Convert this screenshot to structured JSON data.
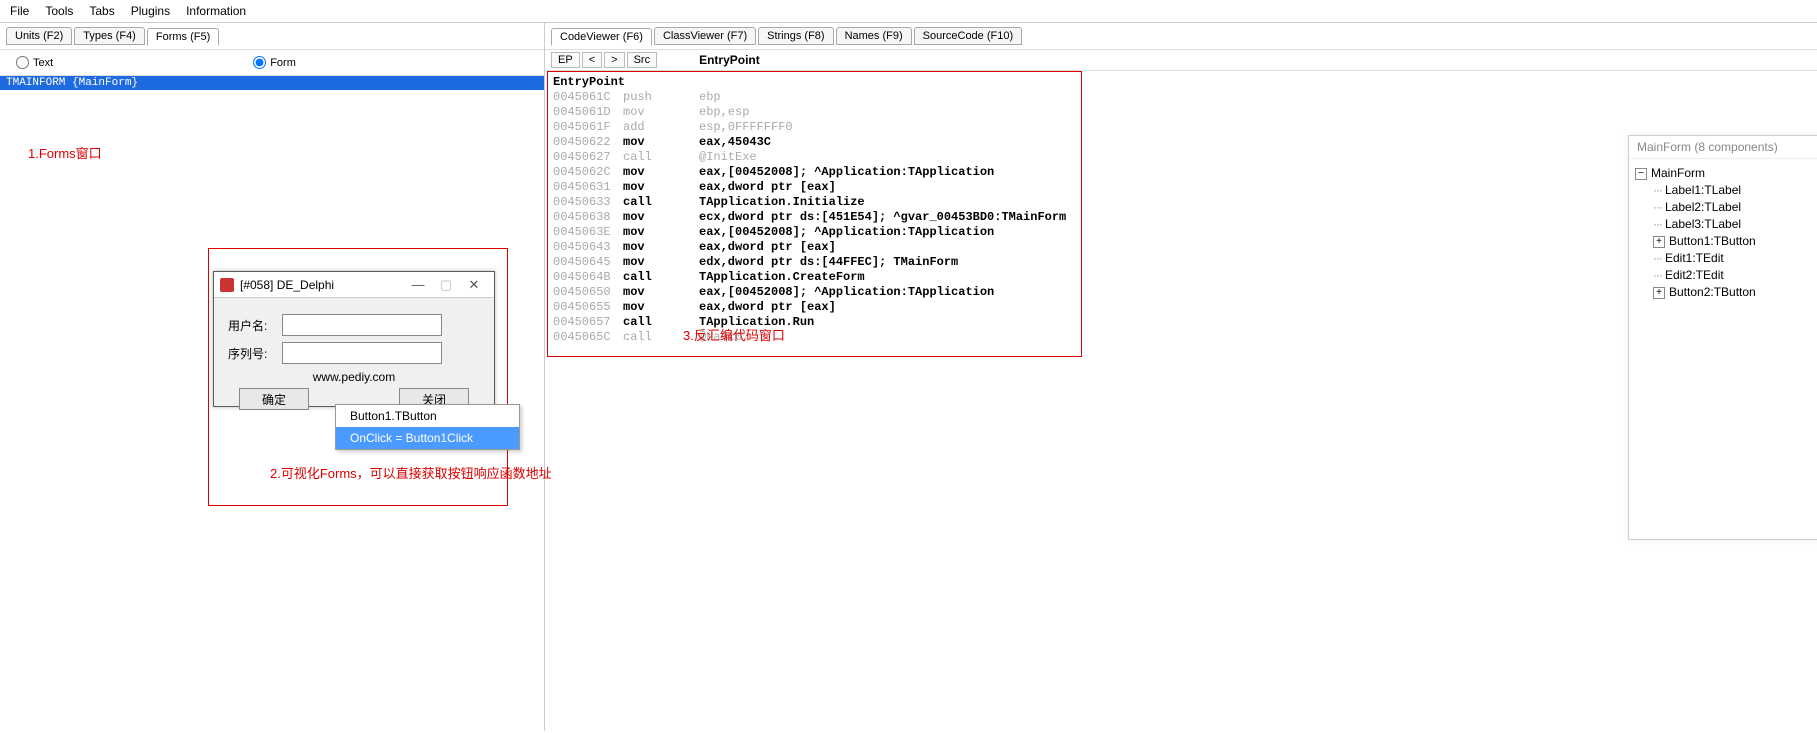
{
  "menu": {
    "file": "File",
    "tools": "Tools",
    "tabs": "Tabs",
    "plugins": "Plugins",
    "info": "Information"
  },
  "left_tabs": {
    "units": "Units (F2)",
    "types": "Types (F4)",
    "forms": "Forms (F5)"
  },
  "radio": {
    "text": "Text",
    "form": "Form"
  },
  "form_list": {
    "item0": "TMAINFORM {MainForm}"
  },
  "annot": {
    "a1": "1.Forms窗口",
    "a2": "2.可视化Forms，可以直接获取按钮响应函数地址",
    "a3": "3.反汇编代码窗口"
  },
  "dform": {
    "title": "[#058] DE_Delphi",
    "lbl_user": "用户名:",
    "lbl_serial": "序列号:",
    "website": "www.pediy.com",
    "btn_ok": "确定",
    "btn_close": "关闭"
  },
  "ctx": {
    "l1": "Button1.TButton",
    "l2": "OnClick = Button1Click"
  },
  "right_tabs": {
    "code": "CodeViewer (F6)",
    "class": "ClassViewer (F7)",
    "strings": "Strings (F8)",
    "names": "Names (F9)",
    "source": "SourceCode (F10)"
  },
  "subbar": {
    "ep": "EP",
    "back": "<",
    "fwd": ">",
    "src": "Src",
    "label": "EntryPoint"
  },
  "code": [
    {
      "addr": "",
      "op": "",
      "arg": "",
      "style": "head",
      "text": "EntryPoint"
    },
    {
      "addr": "0045061C",
      "op": "push",
      "arg": "ebp",
      "style": "f"
    },
    {
      "addr": "0045061D",
      "op": "mov",
      "arg": "ebp,esp",
      "style": "f"
    },
    {
      "addr": "0045061F",
      "op": "add",
      "arg": "esp,0FFFFFFF0",
      "style": "f"
    },
    {
      "addr": "00450622",
      "op": "mov",
      "arg": "eax,45043C",
      "style": "b"
    },
    {
      "addr": "00450627",
      "op": "call",
      "arg": "@InitExe",
      "style": "f"
    },
    {
      "addr": "0045062C",
      "op": "mov",
      "arg": "eax,[00452008]; ^Application:TApplication",
      "style": "b"
    },
    {
      "addr": "00450631",
      "op": "mov",
      "arg": "eax,dword ptr [eax]",
      "style": "b"
    },
    {
      "addr": "00450633",
      "op": "call",
      "arg": "TApplication.Initialize",
      "style": "b"
    },
    {
      "addr": "00450638",
      "op": "mov",
      "arg": "ecx,dword ptr ds:[451E54]; ^gvar_00453BD0:TMainForm",
      "style": "b"
    },
    {
      "addr": "0045063E",
      "op": "mov",
      "arg": "eax,[00452008]; ^Application:TApplication",
      "style": "b"
    },
    {
      "addr": "00450643",
      "op": "mov",
      "arg": "eax,dword ptr [eax]",
      "style": "b"
    },
    {
      "addr": "00450645",
      "op": "mov",
      "arg": "edx,dword ptr ds:[44FFEC]; TMainForm",
      "style": "b"
    },
    {
      "addr": "0045064B",
      "op": "call",
      "arg": "TApplication.CreateForm",
      "style": "b"
    },
    {
      "addr": "00450650",
      "op": "mov",
      "arg": "eax,[00452008]; ^Application:TApplication",
      "style": "b"
    },
    {
      "addr": "00450655",
      "op": "mov",
      "arg": "eax,dword ptr [eax]",
      "style": "b"
    },
    {
      "addr": "00450657",
      "op": "call",
      "arg": "TApplication.Run",
      "style": "b"
    },
    {
      "addr": "0045065C",
      "op": "call",
      "arg": "@Halt0",
      "style": "f"
    }
  ],
  "comp": {
    "header": "MainForm (8 components)",
    "root": "MainForm",
    "items": [
      "Label1:TLabel",
      "Label2:TLabel",
      "Label3:TLabel",
      "Button1:TButton",
      "Edit1:TEdit",
      "Edit2:TEdit",
      "Button2:TButton"
    ],
    "expandable": {
      "3": true,
      "6": true
    }
  }
}
